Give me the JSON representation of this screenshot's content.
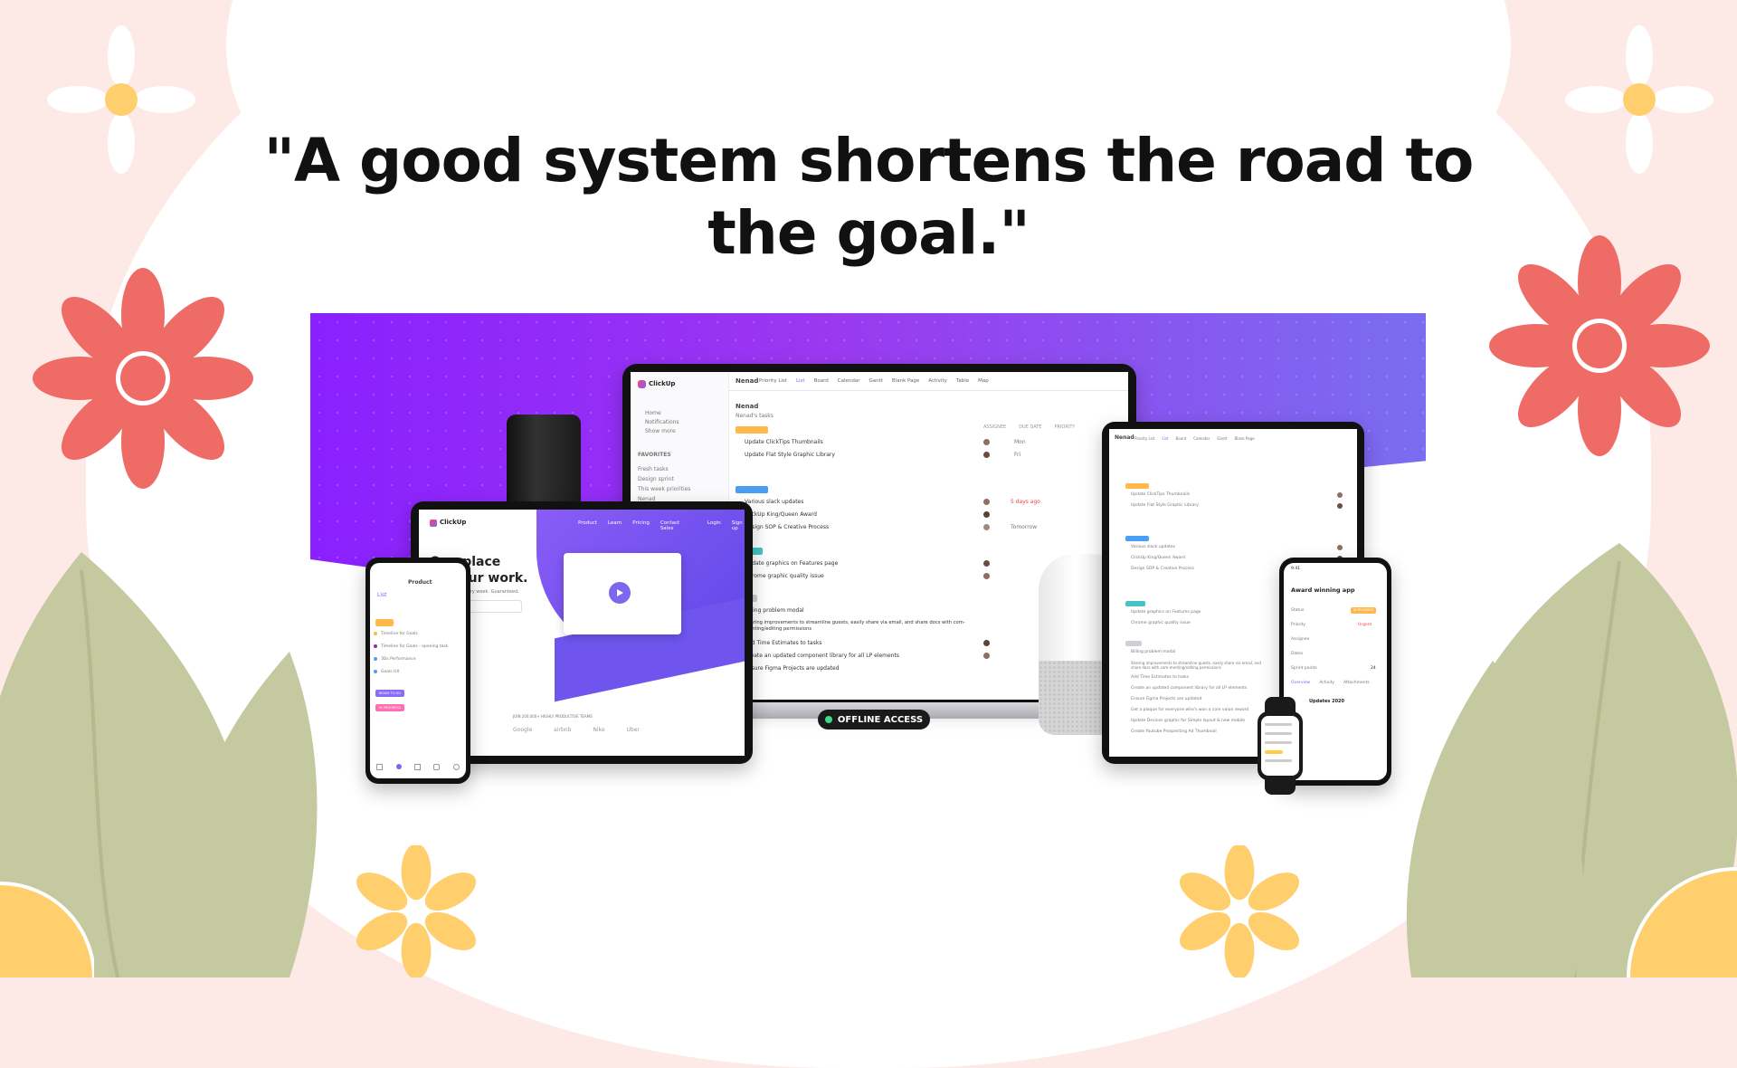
{
  "quote": "\"A good system shortens the road to the goal.\"",
  "colors": {
    "background": "#fdeae6",
    "coral_flower": "#ef6b66",
    "yellow_flower": "#ffcf6e",
    "leaf_green": "#c4c99f",
    "banner_purple": "#8a20ff",
    "accent": "#7b68ee"
  },
  "laptop": {
    "app_name": "ClickUp",
    "workspace": "Nenad",
    "tabs": [
      "Priority List",
      "List",
      "Board",
      "Calendar",
      "Gantt",
      "Blank Page",
      "Activity",
      "Table",
      "Map"
    ],
    "sidebar": [
      "Home",
      "Notifications",
      "Show more"
    ],
    "sidebar_section": "FAVORITES",
    "sidebar_favorites": [
      "Fresh tasks",
      "Design sprint",
      "This week priorities",
      "Nenad"
    ],
    "page_heading": "Nenad",
    "page_sub": "Nenad's tasks",
    "columns": [
      "ASSIGNEE",
      "DUE DATE",
      "PRIORITY"
    ],
    "tasks": [
      "Update ClickTips Thumbnails",
      "Update Flat Style Graphic Library",
      "Various slack updates",
      "ClickUp King/Queen Award",
      "Design SOP & Creative Process",
      "Update graphics on Features page",
      "Chrome graphic quality issue",
      "Billing problem modal",
      "Sharing improvements to streamline guests, easily share via email, and share docs with com-menting/editing permissions",
      "Add Time Estimates to tasks",
      "Create an updated component library for all LP elements",
      "Ensure Figma Projects are updated"
    ],
    "due_dates": [
      "Mon",
      "Fri",
      "5 days ago",
      "",
      "Tomorrow"
    ],
    "offline_label": "OFFLINE ACCESS"
  },
  "tablet_landscape": {
    "logo": "ClickUp",
    "nav": [
      "Product",
      "Learn",
      "Pricing",
      "Contact Sales",
      "Login",
      "Sign up"
    ],
    "hero_line1": "One place",
    "hero_line2": "all your work.",
    "hero_sub": "Save one day every week. Guaranteed.",
    "clients": [
      "Google",
      "airbnb",
      "Nike",
      "Uber"
    ],
    "join_text": "JOIN 200,000+ HIGHLY PRODUCTIVE TEAMS"
  },
  "phone_left": {
    "title": "Product",
    "view": "List",
    "items": [
      "Timeline for Goals",
      "Timeline for Goals - opening task",
      "3Ds Performance",
      "Goals UX"
    ],
    "status_a": "READY TO GO",
    "status_b": "IN PROGRESS"
  },
  "tablet_right": {
    "workspace": "Nenad",
    "tabs": [
      "Priority List",
      "List",
      "Board",
      "Calendar",
      "Gantt",
      "Blank Page"
    ],
    "tasks": [
      "Update ClickTips Thumbnails",
      "Update Flat Style Graphic Library",
      "Various slack updates",
      "ClickUp King/Queen Award",
      "Design SOP & Creative Process",
      "Update graphics on Features page",
      "Chrome graphic quality issue",
      "Billing problem modal",
      "Sharing improvements to streamline guests, easily share via email, and share docs with com-menting/editing permissions",
      "Add Time Estimates to tasks",
      "Create an updated component library for all LP elements",
      "Ensure Figma Projects are updated",
      "Get a plaque for everyone who's won a core value reward",
      "Update Devices graphic for Simple layout & new mobile",
      "Create Youtube Prospecting Ad Thumbnail"
    ]
  },
  "phone_right": {
    "time": "9:41",
    "task_title": "Award winning app",
    "fields": [
      "Status",
      "Priority",
      "Assignee",
      "Dates",
      "Sprint points"
    ],
    "status_value": "IN PROGRESS",
    "priority_value": "Urgent",
    "sprint_points": "24",
    "tabs": [
      "Overview",
      "Activity",
      "Attachments"
    ],
    "update_title": "Updates 2020"
  }
}
